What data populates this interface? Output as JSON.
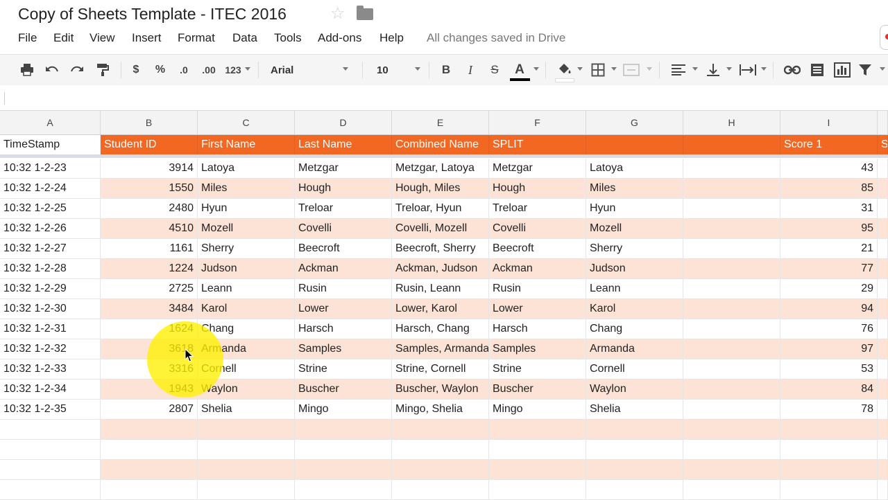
{
  "doc": {
    "title": "Copy of Sheets Template - ITEC 2016",
    "star_icon": "star-icon",
    "folder_icon": "folder-icon"
  },
  "menu": {
    "items": [
      "File",
      "Edit",
      "View",
      "Insert",
      "Format",
      "Data",
      "Tools",
      "Add-ons",
      "Help"
    ],
    "status": "All changes saved in Drive"
  },
  "toolbar": {
    "icons": [
      "print-icon",
      "undo-icon",
      "redo-icon",
      "paint-format-icon"
    ],
    "currency": "$",
    "percent": "%",
    "dec_less": ".0",
    "dec_more": ".00",
    "number_format": "123",
    "font": "Arial",
    "font_size": "10",
    "bold": "B",
    "italic": "I",
    "strike": "S",
    "text_color": "A",
    "right_icons": [
      "fill-color-icon",
      "borders-icon",
      "merge-icon",
      "align-left-icon",
      "valign-bottom-icon",
      "text-wrap-icon",
      "link-icon",
      "comment-icon",
      "chart-icon",
      "filter-icon"
    ]
  },
  "columns": [
    "A",
    "B",
    "C",
    "D",
    "E",
    "F",
    "G",
    "H",
    "I"
  ],
  "header": [
    "TimeStamp",
    "Student ID",
    "First Name",
    "Last Name",
    "Combined Name",
    "SPLIT",
    "",
    "",
    "Score 1",
    "S"
  ],
  "rows": [
    [
      "10:32 1-2-23",
      "3914",
      "Latoya",
      "Metzgar",
      "Metzgar, Latoya",
      "Metzgar",
      "Latoya",
      "",
      "43"
    ],
    [
      "10:32 1-2-24",
      "1550",
      "Miles",
      "Hough",
      "Hough, Miles",
      "Hough",
      "Miles",
      "",
      "85"
    ],
    [
      "10:32 1-2-25",
      "2480",
      "Hyun",
      "Treloar",
      "Treloar, Hyun",
      "Treloar",
      "Hyun",
      "",
      "31"
    ],
    [
      "10:32 1-2-26",
      "4510",
      "Mozell",
      "Covelli",
      "Covelli, Mozell",
      "Covelli",
      "Mozell",
      "",
      "95"
    ],
    [
      "10:32 1-2-27",
      "1161",
      "Sherry",
      "Beecroft",
      "Beecroft, Sherry",
      "Beecroft",
      "Sherry",
      "",
      "21"
    ],
    [
      "10:32 1-2-28",
      "1224",
      "Judson",
      "Ackman",
      "Ackman, Judson",
      "Ackman",
      "Judson",
      "",
      "77"
    ],
    [
      "10:32 1-2-29",
      "2725",
      "Leann",
      "Rusin",
      "Rusin, Leann",
      "Rusin",
      "Leann",
      "",
      "29"
    ],
    [
      "10:32 1-2-30",
      "3484",
      "Karol",
      "Lower",
      "Lower, Karol",
      "Lower",
      "Karol",
      "",
      "94"
    ],
    [
      "10:32 1-2-31",
      "1624",
      "Chang",
      "Harsch",
      "Harsch, Chang",
      "Harsch",
      "Chang",
      "",
      "76"
    ],
    [
      "10:32 1-2-32",
      "3618",
      "Armanda",
      "Samples",
      "Samples, Armanda",
      "Samples",
      "Armanda",
      "",
      "97"
    ],
    [
      "10:32 1-2-33",
      "3316",
      "Cornell",
      "Strine",
      "Strine, Cornell",
      "Strine",
      "Cornell",
      "",
      "53"
    ],
    [
      "10:32 1-2-34",
      "1943",
      "Waylon",
      "Buscher",
      "Buscher, Waylon",
      "Buscher",
      "Waylon",
      "",
      "84"
    ],
    [
      "10:32 1-2-35",
      "2807",
      "Shelia",
      "Mingo",
      "Mingo, Shelia",
      "Mingo",
      "Shelia",
      "",
      "78"
    ],
    [
      "",
      "",
      "",
      "",
      "",
      "",
      "",
      "",
      ""
    ],
    [
      "",
      "",
      "",
      "",
      "",
      "",
      "",
      "",
      ""
    ],
    [
      "",
      "",
      "",
      "",
      "",
      "",
      "",
      "",
      ""
    ],
    [
      "",
      "",
      "",
      "",
      "",
      "",
      "",
      "",
      ""
    ]
  ],
  "colors": {
    "header_orange": "#f26722",
    "band_peach": "#fde3d6",
    "highlight_yellow": "#fff000"
  }
}
